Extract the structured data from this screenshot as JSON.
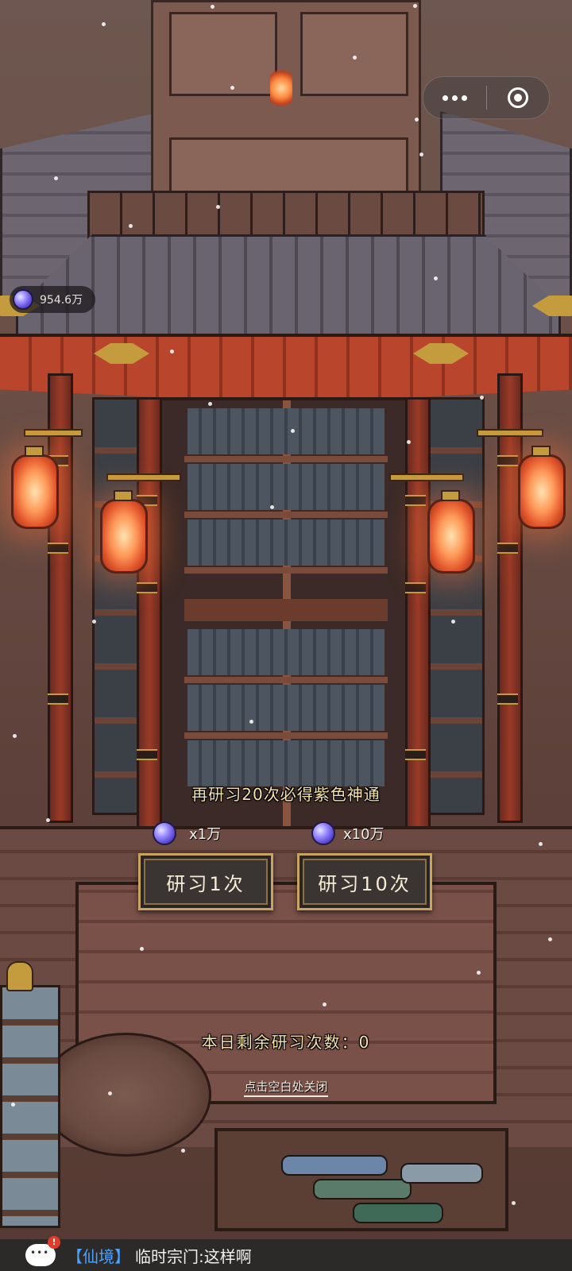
{
  "top_menu": {
    "more_icon": "more-dots-icon",
    "close_icon": "target-icon"
  },
  "currency": {
    "icon": "spirit-gem-icon",
    "value": "954.6万"
  },
  "study": {
    "pity_hint": "再研习20次必得紫色神通",
    "single": {
      "cost": "x1万",
      "label": "研习1次"
    },
    "ten": {
      "cost": "x10万",
      "label": "研习10次"
    },
    "remaining_label": "本日剩余研习次数：",
    "remaining_value": "0",
    "close_hint": "点击空白处关闭"
  },
  "chat": {
    "badge": "!",
    "channel": "【仙境】",
    "message": "临时宗门:这样啊"
  },
  "colors": {
    "gem": "#7b6cf0",
    "button_border": "#c8a463",
    "hint_text": "#f4e2a8",
    "chat_channel": "#4aa3ff"
  }
}
